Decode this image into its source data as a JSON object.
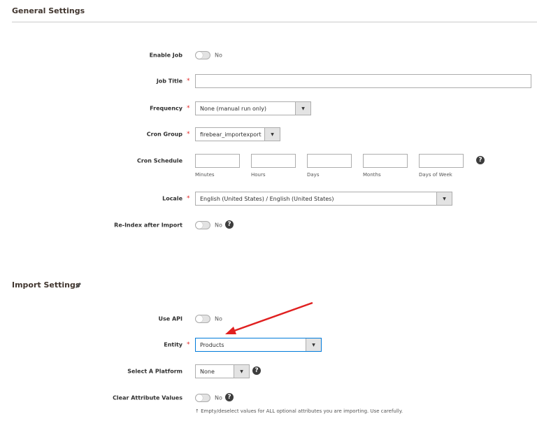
{
  "general": {
    "title": "General Settings",
    "enable_job": {
      "label": "Enable Job",
      "value": "No"
    },
    "job_title": {
      "label": "Job Title",
      "value": ""
    },
    "frequency": {
      "label": "Frequency",
      "value": "None (manual run only)"
    },
    "cron_group": {
      "label": "Cron Group",
      "value": "firebear_importexport"
    },
    "cron_schedule": {
      "label": "Cron Schedule",
      "fields": [
        "Minutes",
        "Hours",
        "Days",
        "Months",
        "Days of Week"
      ]
    },
    "locale": {
      "label": "Locale",
      "value": "English (United States) / English (United States)"
    },
    "reindex": {
      "label": "Re-Index after Import",
      "value": "No"
    }
  },
  "import": {
    "title": "Import Settings",
    "use_api": {
      "label": "Use API",
      "value": "No"
    },
    "entity": {
      "label": "Entity",
      "value": "Products"
    },
    "platform": {
      "label": "Select A Platform",
      "value": "None"
    },
    "clear_attr": {
      "label": "Clear Attribute Values",
      "value": "No",
      "note": "↑ Empty/deselect values for ALL optional attributes you are importing. Use carefully."
    }
  },
  "required_mark": "*",
  "help_glyph": "?",
  "dropdown_glyph": "▼",
  "colors": {
    "annotation_arrow": "#e02020",
    "focus_border": "#007bdb"
  }
}
